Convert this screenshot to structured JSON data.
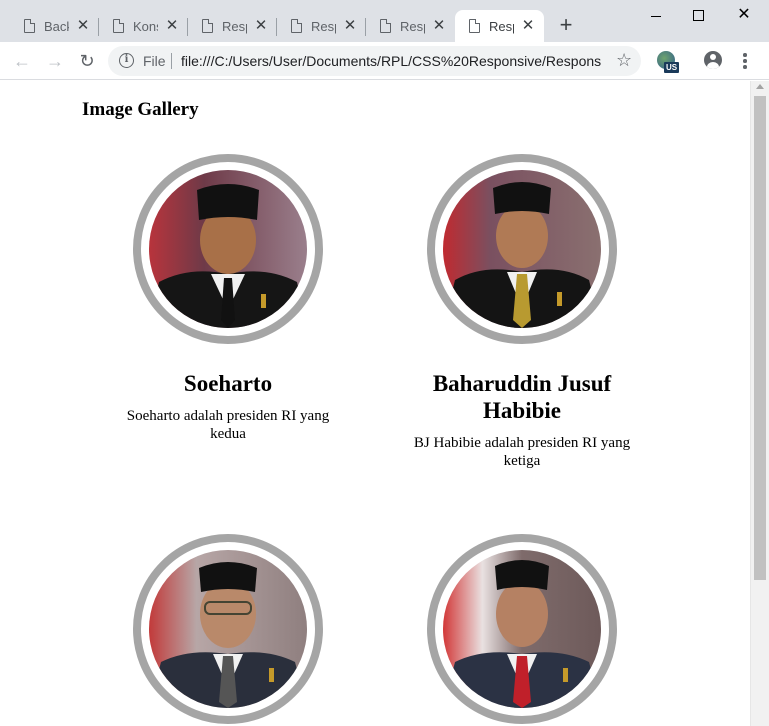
{
  "browser": {
    "tabs": [
      {
        "label": "Back"
      },
      {
        "label": "Kons"
      },
      {
        "label": "Resp"
      },
      {
        "label": "Resp"
      },
      {
        "label": "Resp"
      },
      {
        "label": "Resp",
        "active": true
      }
    ],
    "scheme_label": "File",
    "url": "file:///C:/Users/User/Documents/RPL/CSS%20Responsive/Respons...",
    "extension_badge": "US",
    "icons": {
      "back": "arrow-left-icon",
      "forward": "arrow-right-icon",
      "reload": "reload-icon",
      "info": "info-icon",
      "bookmark": "star-icon",
      "profile": "profile-icon",
      "menu": "kebab-menu-icon",
      "new_tab": "plus-icon"
    }
  },
  "page": {
    "title": "Image Gallery",
    "gallery": [
      {
        "name": "Soeharto",
        "description": "Soeharto adalah presiden RI yang kedua"
      },
      {
        "name": "Baharuddin Jusuf Habibie",
        "description": "BJ Habibie adalah presiden RI yang ketiga"
      },
      {
        "name": "",
        "description": ""
      },
      {
        "name": "",
        "description": ""
      }
    ]
  },
  "colors": {
    "ring": "#a5a5a5",
    "tabstrip": "#dee1e6",
    "omnibox": "#f1f3f4"
  }
}
